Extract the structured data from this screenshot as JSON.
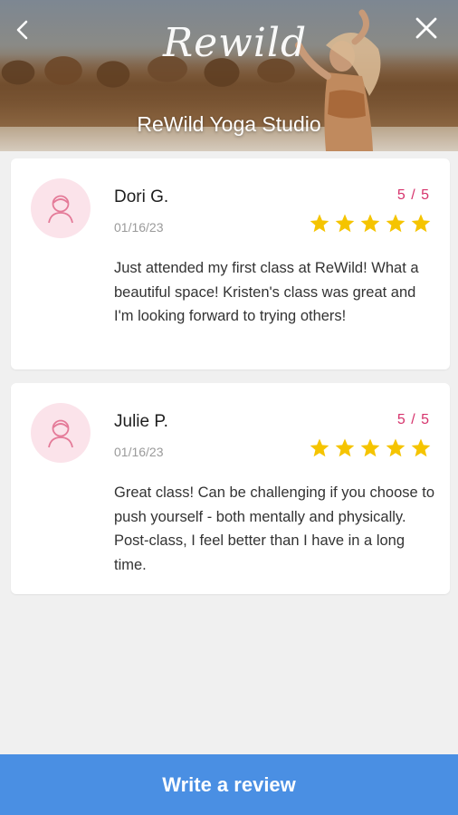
{
  "header": {
    "logo_text": "Rewild",
    "title": "ReWild Yoga Studio",
    "back_icon": "chevron-left-icon",
    "close_icon": "close-icon"
  },
  "reviews": [
    {
      "name": "Dori G.",
      "date": "01/16/23",
      "score_text": "5 / 5",
      "rating": 5,
      "text": "Just attended my first class at ReWild! What a beautiful space! Kristen's class was great and I'm looking forward to trying others!"
    },
    {
      "name": "Julie P.",
      "date": "01/16/23",
      "score_text": "5 / 5",
      "rating": 5,
      "text": "Great class! Can be challenging if you choose to push yourself - both mentally and physically. Post-class, I feel better than I have in a long time."
    }
  ],
  "footer": {
    "write_review_label": "Write a review"
  },
  "colors": {
    "accent": "#4a8fe3",
    "score": "#d6336c",
    "star": "#f5c400",
    "avatar_bg": "#fbe3ea",
    "avatar_icon": "#e47a98"
  }
}
